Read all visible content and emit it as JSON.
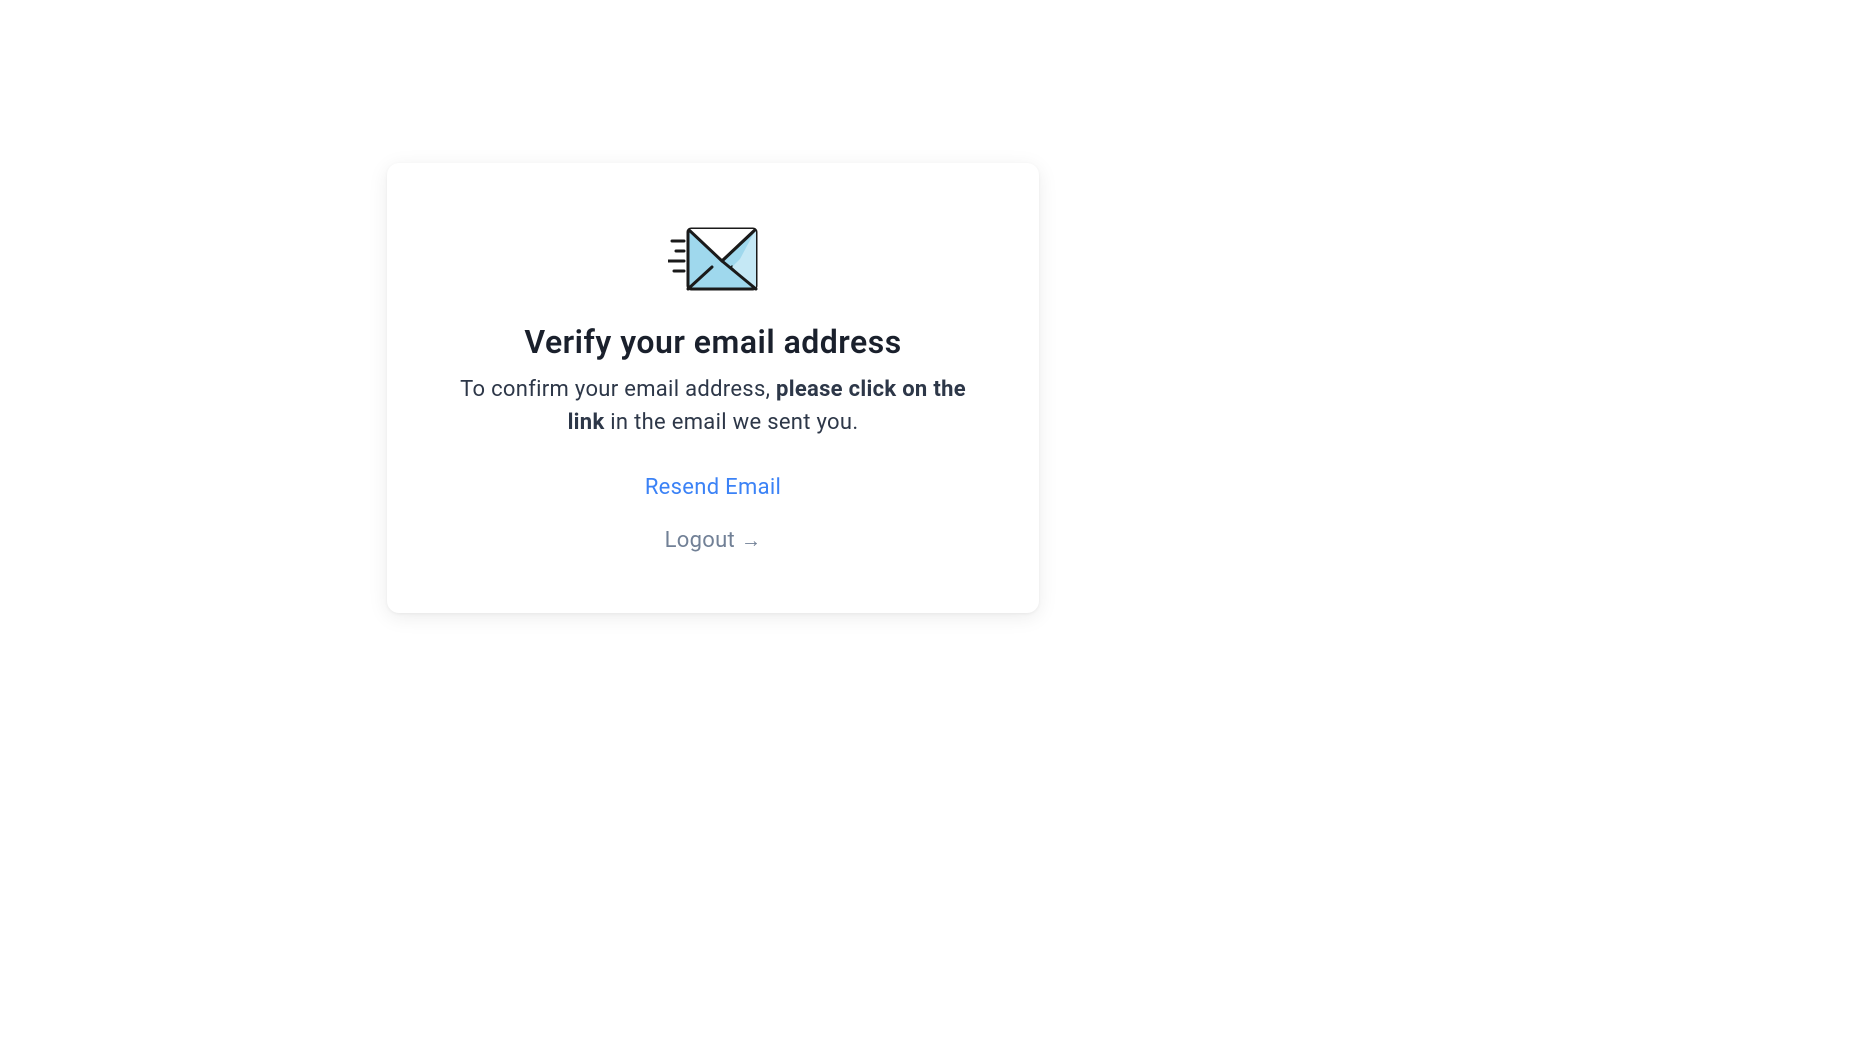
{
  "card": {
    "title": "Verify your email address",
    "description_part1": "To confirm your email address, ",
    "description_bold": "please click on the link",
    "description_part2": " in the email we sent you.",
    "resend_label": "Resend Email",
    "logout_label": "Logout",
    "logout_arrow": "→"
  }
}
